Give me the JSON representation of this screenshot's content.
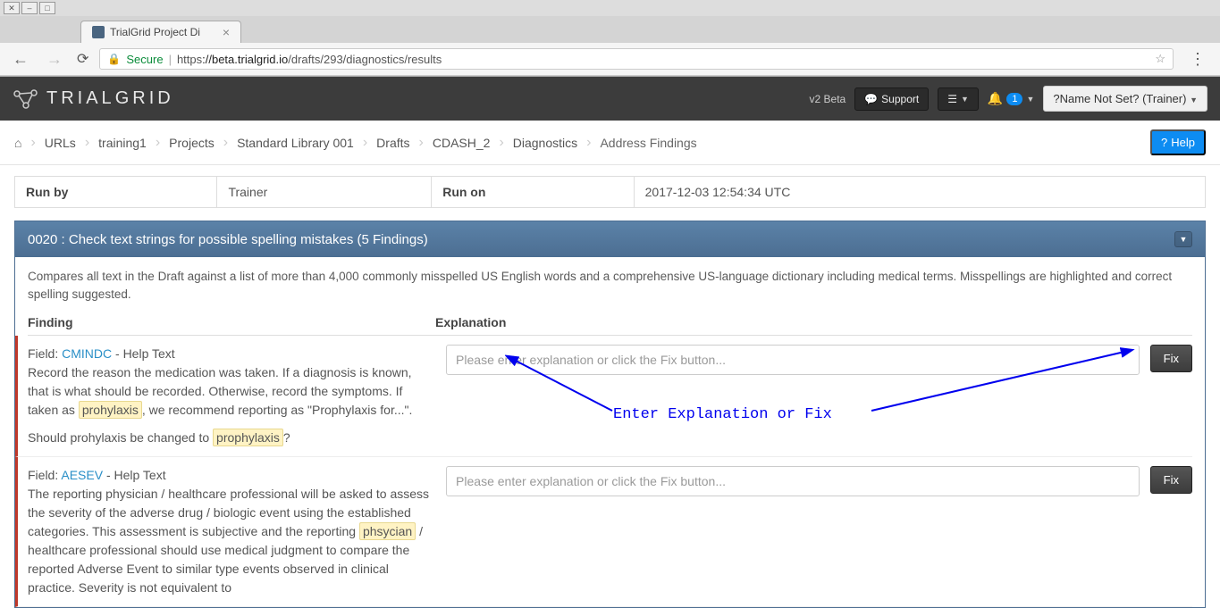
{
  "browser": {
    "tab_title": "TrialGrid Project Di",
    "url_secure": "Secure",
    "url_proto": "https",
    "url_domain": "://beta.trialgrid.io",
    "url_path": "/drafts/293/diagnostics/results"
  },
  "header": {
    "logo_a": "TRIAL",
    "logo_b": "GRID",
    "beta": "v2 Beta",
    "support": "Support",
    "notif_count": "1",
    "user": "?Name Not Set? (Trainer)"
  },
  "breadcrumb": {
    "items": [
      "URLs",
      "training1",
      "Projects",
      "Standard Library 001",
      "Drafts",
      "CDASH_2",
      "Diagnostics",
      "Address Findings"
    ],
    "help": "Help"
  },
  "run_info": {
    "run_by_label": "Run by",
    "run_by_val": "Trainer",
    "run_on_label": "Run on",
    "run_on_val": "2017-12-03 12:54:34 UTC"
  },
  "panel": {
    "title": "0020 : Check text strings for possible spelling mistakes (5 Findings)",
    "desc": "Compares all text in the Draft against a list of more than 4,000 commonly misspelled US English words and a comprehensive US-language dictionary including medical terms. Misspellings are highlighted and correct spelling suggested.",
    "col_finding": "Finding",
    "col_explain": "Explanation",
    "placeholder": "Please enter explanation or click the Fix button...",
    "fix": "Fix"
  },
  "findings": [
    {
      "prefix": "Field: ",
      "link": "CMINDC",
      "suffix": " - Help Text",
      "text_a": "Record the reason the medication was taken. If a diagnosis is known, that is what should be recorded. Otherwise, record the symptoms. If taken as ",
      "hl": "prohylaxis",
      "text_b": ", we recommend reporting as \"Prophylaxis for...\".",
      "suggest_a": "Should prohylaxis be changed to ",
      "suggest_hl": "prophylaxis",
      "suggest_b": "?"
    },
    {
      "prefix": "Field: ",
      "link": "AESEV",
      "suffix": " - Help Text",
      "text_a": "The reporting physician / healthcare professional will be asked to assess the severity of the adverse drug / biologic event using the established categories. This assessment is subjective and the reporting ",
      "hl": "phsycian",
      "text_b": " / healthcare professional should use medical judgment to compare the reported Adverse Event to similar type events observed in clinical practice. Severity is not equivalent to"
    }
  ],
  "annotation": "Enter Explanation or Fix"
}
